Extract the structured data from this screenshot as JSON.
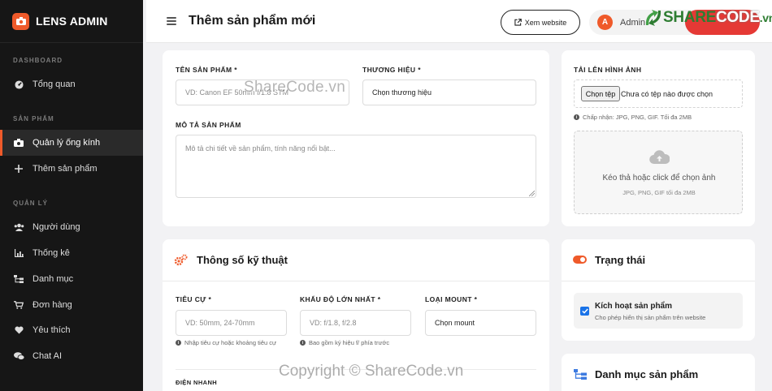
{
  "brand": {
    "name": "LENS ADMIN"
  },
  "sidebar": {
    "sections": [
      {
        "title": "DASHBOARD",
        "items": [
          {
            "label": "Tổng quan",
            "icon": "dashboard-icon"
          }
        ]
      },
      {
        "title": "SẢN PHẨM",
        "items": [
          {
            "label": "Quản lý ống kính",
            "icon": "camera-icon",
            "active": true
          },
          {
            "label": "Thêm sản phẩm",
            "icon": "plus-icon"
          }
        ]
      },
      {
        "title": "QUẢN LÝ",
        "items": [
          {
            "label": "Người dùng",
            "icon": "users-icon"
          },
          {
            "label": "Thống kê",
            "icon": "chart-icon"
          },
          {
            "label": "Danh mục",
            "icon": "sitemap-icon"
          },
          {
            "label": "Đơn hàng",
            "icon": "cart-icon"
          },
          {
            "label": "Yêu thích",
            "icon": "heart-icon"
          },
          {
            "label": "Chat AI",
            "icon": "chat-icon"
          }
        ]
      }
    ]
  },
  "header": {
    "title": "Thêm sản phẩm mới",
    "view_site": "Xem website",
    "avatar_letter": "A",
    "user_name": "Admin"
  },
  "watermark": {
    "share": "SHARE",
    "code": "CODE",
    "vn": ".vn",
    "center": "ShareCode.vn",
    "bottom": "Copyright © ShareCode.vn"
  },
  "basic_info": {
    "name_label": "TÊN SẢN PHẨM *",
    "name_placeholder": "VD: Canon EF 50mm f/1.8 STM",
    "brand_label": "THƯƠNG HIỆU *",
    "brand_value": "Chọn thương hiệu",
    "desc_label": "MÔ TẢ SẢN PHẨM",
    "desc_placeholder": "Mô tả chi tiết về sản phẩm, tính năng nổi bật..."
  },
  "specs": {
    "title": "Thông số kỹ thuật",
    "focal_label": "TIÊU CỰ *",
    "focal_placeholder": "VD: 50mm, 24-70mm",
    "focal_hint": "Nhập tiêu cự hoặc khoảng tiêu cự",
    "aperture_label": "KHẨU ĐỘ LỚN NHẤT *",
    "aperture_placeholder": "VD: f/1.8, f/2.8",
    "aperture_hint": "Bao gồm ký hiệu f/ phía trước",
    "mount_label": "LOẠI MOUNT *",
    "mount_value": "Chọn mount",
    "next_label": "ĐIỆN NHANH"
  },
  "upload": {
    "label": "TẢI LÊN HÌNH ẢNH",
    "button": "Chọn tệp",
    "status": "Chưa có tệp nào được chọn",
    "accept_hint": "Chấp nhận: JPG, PNG, GIF. Tối đa 2MB",
    "drop_main": "Kéo thả hoặc click để chọn ảnh",
    "drop_sub": "JPG, PNG, GIF tối đa 2MB"
  },
  "status": {
    "title": "Trạng thái",
    "check_label": "Kích hoạt sản phẩm",
    "check_desc": "Cho phép hiển thị sản phẩm trên website"
  },
  "category": {
    "title": "Danh mục sản phẩm"
  },
  "colors": {
    "accent": "#ef5a2a",
    "sidebar_bg": "#161616",
    "checkbox": "#1a73e8"
  }
}
